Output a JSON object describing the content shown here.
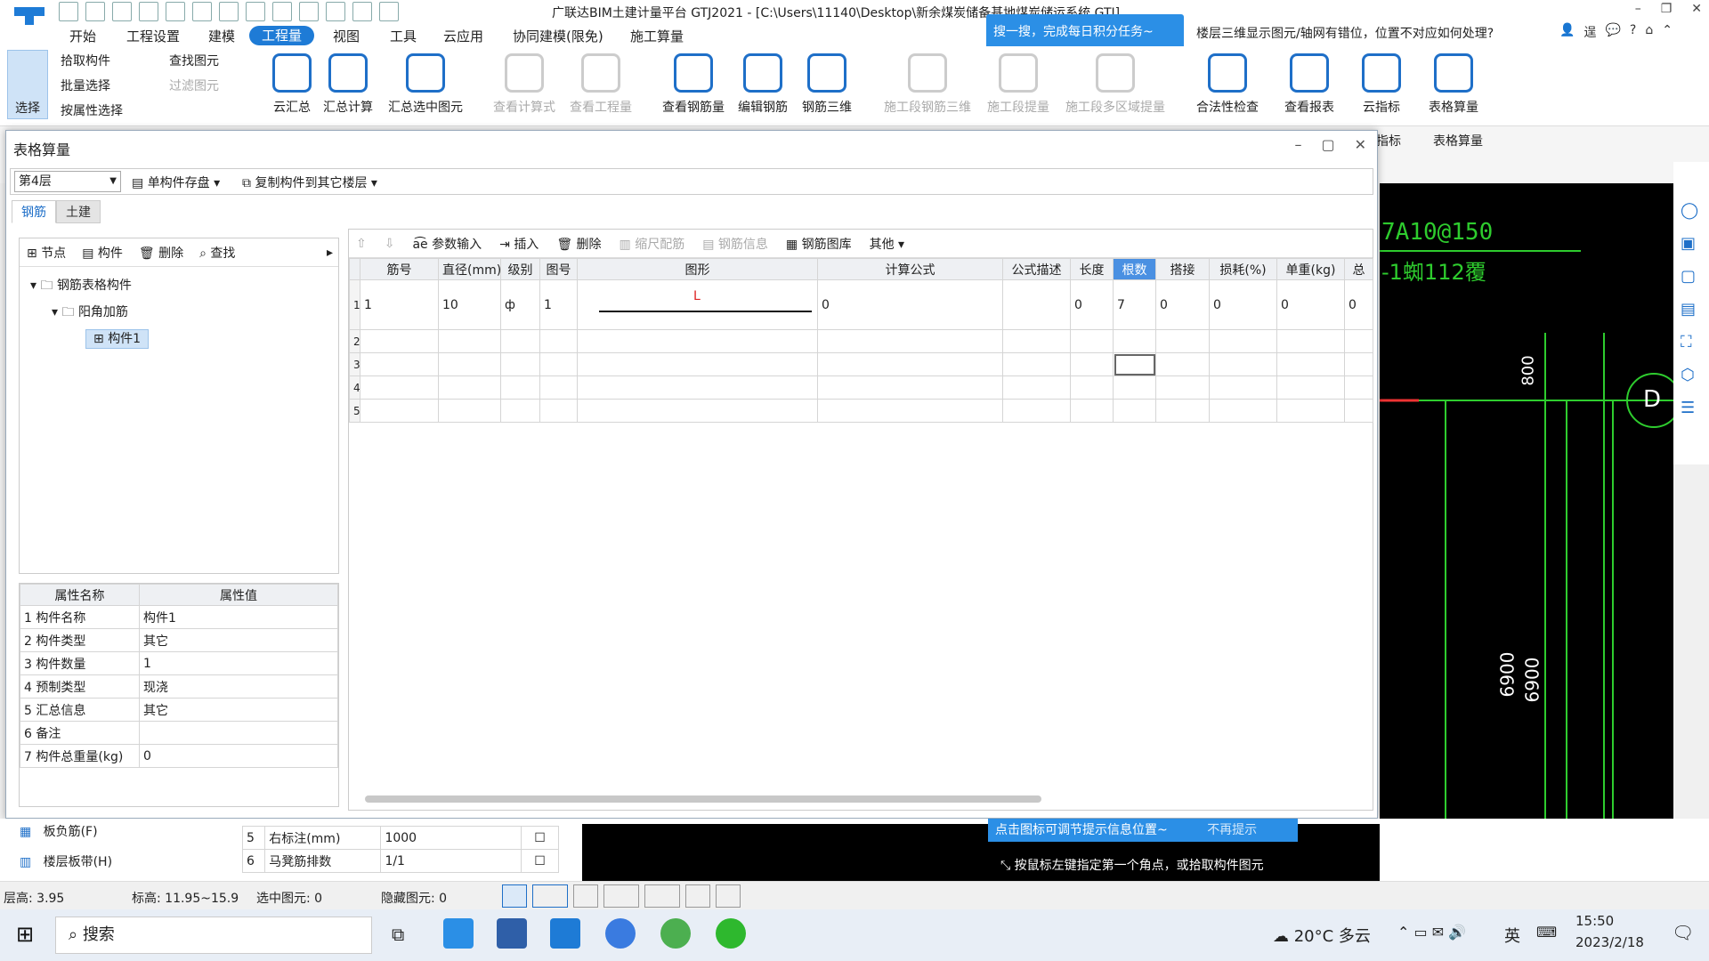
{
  "app": {
    "window_title": "广联达BIM土建计量平台 GTJ2021 - [C:\\Users\\11140\\Desktop\\新余煤炭储备基地煤炭储运系统.GTJ]",
    "notification": "搜一搜，完成每日积分任务~",
    "search_question": "楼层三维显示图元/轴网有错位，位置不对应如何处理?",
    "right_label": "逞"
  },
  "menu": [
    "开始",
    "工程设置",
    "建模",
    "工程量",
    "视图",
    "工具",
    "云应用",
    "协同建模(限免)",
    "施工算量"
  ],
  "menu_active": "工程量",
  "ribbon": {
    "select": "选择",
    "pick": "拾取构件",
    "batch": "批量选择",
    "byattr": "按属性选择",
    "find_elem": "查找图元",
    "filter_elem": "过滤图元",
    "big": [
      "云汇总",
      "汇总计算",
      "汇总选中图元",
      "查看计算式",
      "查看工程量",
      "查看钢筋量",
      "编辑钢筋",
      "钢筋三维",
      "施工段钢筋三维",
      "施工段提量",
      "施工段多区域提量",
      "合法性检查",
      "查看报表",
      "云指标",
      "表格算量"
    ],
    "group_labels": [
      "指标",
      "表格算量"
    ]
  },
  "dialog": {
    "title": "表格算量",
    "floor": "第4层",
    "save_single": "单构件存盘",
    "copy_to_floor": "复制构件到其它楼层",
    "tabs": [
      "钢筋",
      "土建"
    ],
    "left_toolbar": [
      "节点",
      "构件",
      "删除",
      "查找"
    ],
    "tree": {
      "root": "钢筋表格构件",
      "group": "阳角加筋",
      "item": "构件1"
    },
    "props_headers": [
      "属性名称",
      "属性值"
    ],
    "props": [
      {
        "n": "1",
        "name": "构件名称",
        "value": "构件1"
      },
      {
        "n": "2",
        "name": "构件类型",
        "value": "其它"
      },
      {
        "n": "3",
        "name": "构件数量",
        "value": "1"
      },
      {
        "n": "4",
        "name": "预制类型",
        "value": "现浇"
      },
      {
        "n": "5",
        "name": "汇总信息",
        "value": "其它"
      },
      {
        "n": "6",
        "name": "备注",
        "value": ""
      },
      {
        "n": "7",
        "name": "构件总重量(kg)",
        "value": "0"
      }
    ],
    "grid_toolbar": [
      "参数输入",
      "插入",
      "删除",
      "缩尺配筋",
      "钢筋信息",
      "钢筋图库",
      "其他"
    ],
    "grid_headers": [
      "筋号",
      "直径(mm)",
      "级别",
      "图号",
      "图形",
      "计算公式",
      "公式描述",
      "长度",
      "根数",
      "搭接",
      "损耗(%)",
      "单重(kg)",
      "总"
    ],
    "grid_rows": [
      {
        "n": "1",
        "jin": "1",
        "dia": "10",
        "grade": "ф",
        "fig": "1",
        "shape_label": "L",
        "formula": "0",
        "desc": "",
        "len": "0",
        "count": "7",
        "lap": "0",
        "loss": "0",
        "unit": "0",
        "total": "0"
      },
      {
        "n": "2"
      },
      {
        "n": "3"
      },
      {
        "n": "4"
      },
      {
        "n": "5"
      }
    ]
  },
  "bottom_panel": {
    "left_items": [
      "板负筋(F)",
      "楼层板带(H)"
    ],
    "rows": [
      {
        "n": "5",
        "name": "右标注(mm)",
        "value": "1000"
      },
      {
        "n": "6",
        "name": "马凳筋排数",
        "value": "1/1"
      }
    ],
    "hint1": "点击图标可调节提示信息位置~",
    "hint1b": "不再提示",
    "hint2": "按鼠标左键指定第一个角点，或拾取构件图元"
  },
  "cad": {
    "text1": "7A10@150",
    "text2": "-1蜘112覆",
    "dim1": "800",
    "dim2": "6900",
    "dim3": "6900",
    "axis": "D"
  },
  "status": {
    "floor_h": "层高:",
    "floor_h_v": "3.95",
    "elev": "标高:",
    "elev_v": "11.95~15.9",
    "selected": "选中图元:",
    "selected_v": "0",
    "hidden": "隐藏图元:",
    "hidden_v": "0"
  },
  "taskbar": {
    "search": "搜索",
    "weather": "20°C 多云",
    "ime": "英",
    "time": "15:50",
    "date": "2023/2/18"
  },
  "colors": {
    "accent": "#1e7bd6",
    "cad_bg": "#000000",
    "cad_line": "#2ecc2e",
    "notif": "#2b8fe6"
  }
}
